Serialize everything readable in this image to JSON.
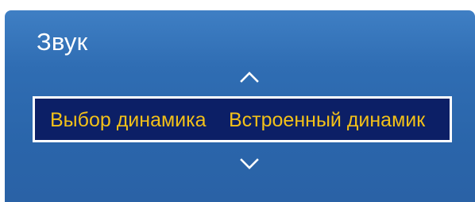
{
  "menu": {
    "title": "Звук",
    "setting_label": "Выбор динамика",
    "setting_value": "Встроенный динамик"
  },
  "icons": {
    "up": "chevron-up-icon",
    "down": "chevron-down-icon"
  },
  "colors": {
    "panel_top": "#3f7fc4",
    "panel_bottom": "#2a62a6",
    "selection_bg": "#0c1f66",
    "selection_border": "#ffffff",
    "selection_text": "#f2c019",
    "title_text": "#ffffff"
  }
}
